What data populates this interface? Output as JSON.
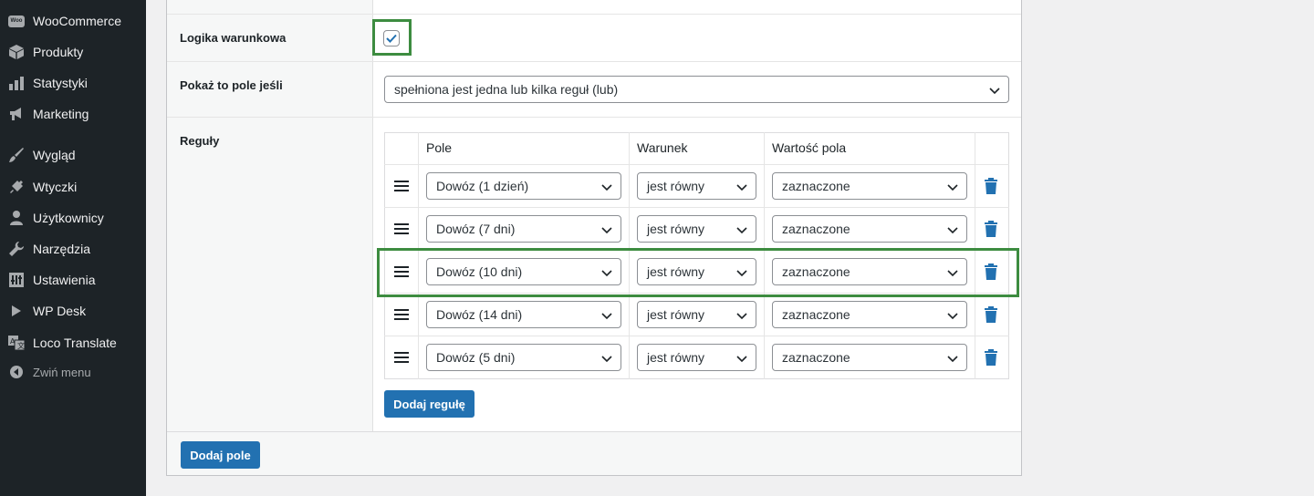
{
  "sidebar": {
    "items": [
      {
        "label": "WooCommerce",
        "icon": "woocommerce-icon"
      },
      {
        "label": "Produkty",
        "icon": "box-icon"
      },
      {
        "label": "Statystyki",
        "icon": "bar-chart-icon"
      },
      {
        "label": "Marketing",
        "icon": "megaphone-icon"
      },
      {
        "label": "Wygląd",
        "icon": "paintbrush-icon"
      },
      {
        "label": "Wtyczki",
        "icon": "plug-icon"
      },
      {
        "label": "Użytkownicy",
        "icon": "user-icon"
      },
      {
        "label": "Narzędzia",
        "icon": "wrench-icon"
      },
      {
        "label": "Ustawienia",
        "icon": "settings-sliders-icon"
      },
      {
        "label": "WP Desk",
        "icon": "play-icon"
      },
      {
        "label": "Loco Translate",
        "icon": "translate-icon"
      }
    ],
    "collapse_label": "Zwiń menu"
  },
  "form": {
    "conditional_logic_label": "Logika warunkowa",
    "conditional_logic_checked": true,
    "show_if_label": "Pokaż to pole jeśli",
    "show_if_value": "spełniona jest jedna lub kilka reguł (lub)",
    "rules_label": "Reguły"
  },
  "rules_table": {
    "headers": [
      "Pole",
      "Warunek",
      "Wartość pola"
    ],
    "rows": [
      {
        "field": "Dowóz (1 dzień)",
        "condition": "jest równy",
        "value": "zaznaczone"
      },
      {
        "field": "Dowóz (7 dni)",
        "condition": "jest równy",
        "value": "zaznaczone"
      },
      {
        "field": "Dowóz (10 dni)",
        "condition": "jest równy",
        "value": "zaznaczone"
      },
      {
        "field": "Dowóz (14 dni)",
        "condition": "jest równy",
        "value": "zaznaczone"
      },
      {
        "field": "Dowóz (5 dni)",
        "condition": "jest równy",
        "value": "zaznaczone"
      }
    ],
    "add_rule_label": "Dodaj regułę"
  },
  "footer": {
    "add_field_label": "Dodaj pole"
  },
  "colors": {
    "accent": "#2271b1",
    "highlight": "#3d8c40",
    "sidebar_bg": "#1d2327"
  }
}
